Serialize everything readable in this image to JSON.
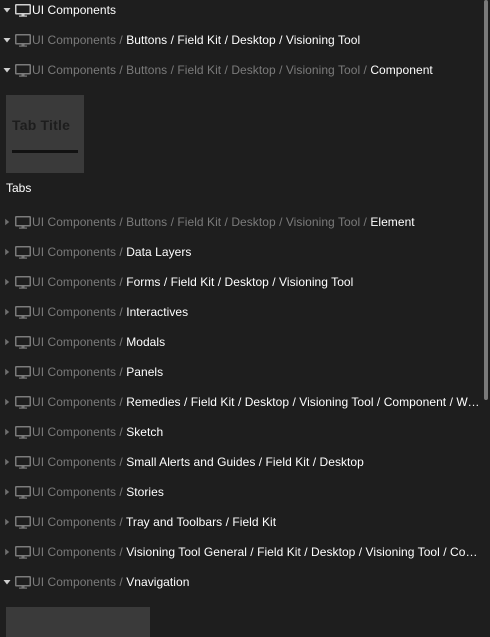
{
  "tree": {
    "rows": [
      {
        "expanded": true,
        "prefix": "",
        "leaf": "UI Components"
      },
      {
        "expanded": true,
        "prefix": "UI Components /",
        "leaf": "Buttons / Field Kit / Desktop / Visioning Tool"
      },
      {
        "expanded": true,
        "prefix": "UI Components / Buttons / Field Kit / Desktop / Visioning Tool /",
        "leaf": "Component"
      },
      {
        "expanded": false,
        "prefix": "UI Components / Buttons / Field Kit / Desktop / Visioning Tool /",
        "leaf": "Element"
      },
      {
        "expanded": false,
        "prefix": "UI Components /",
        "leaf": "Data Layers"
      },
      {
        "expanded": false,
        "prefix": "UI Components /",
        "leaf": "Forms / Field Kit / Desktop / Visioning Tool"
      },
      {
        "expanded": false,
        "prefix": "UI Components /",
        "leaf": "Interactives"
      },
      {
        "expanded": false,
        "prefix": "UI Components /",
        "leaf": "Modals"
      },
      {
        "expanded": false,
        "prefix": "UI Components /",
        "leaf": "Panels"
      },
      {
        "expanded": false,
        "prefix": "UI Components /",
        "leaf": "Remedies / Field Kit / Desktop / Visioning Tool / Component / Work..."
      },
      {
        "expanded": false,
        "prefix": "UI Components /",
        "leaf": "Sketch"
      },
      {
        "expanded": false,
        "prefix": "UI Components /",
        "leaf": "Small Alerts and Guides / Field Kit / Desktop"
      },
      {
        "expanded": false,
        "prefix": "UI Components /",
        "leaf": "Stories"
      },
      {
        "expanded": false,
        "prefix": "UI Components /",
        "leaf": "Tray and Toolbars / Field Kit"
      },
      {
        "expanded": false,
        "prefix": "UI Components /",
        "leaf": "Visioning Tool General / Field Kit / Desktop / Visioning Tool / Comp..."
      },
      {
        "expanded": true,
        "prefix": "UI Components /",
        "leaf": "Vnavigation"
      }
    ]
  },
  "component_thumbnail": {
    "preview_text": "Tab Title",
    "caption": "Tabs"
  },
  "colors": {
    "background": "#1e1e1e",
    "text_primary": "#ffffff",
    "text_dim": "#7b7b7b",
    "thumbnail_bg": "#3a3a3a"
  },
  "icons": {
    "expand_toggle": "chevron-icon",
    "frame": "monitor-icon"
  }
}
